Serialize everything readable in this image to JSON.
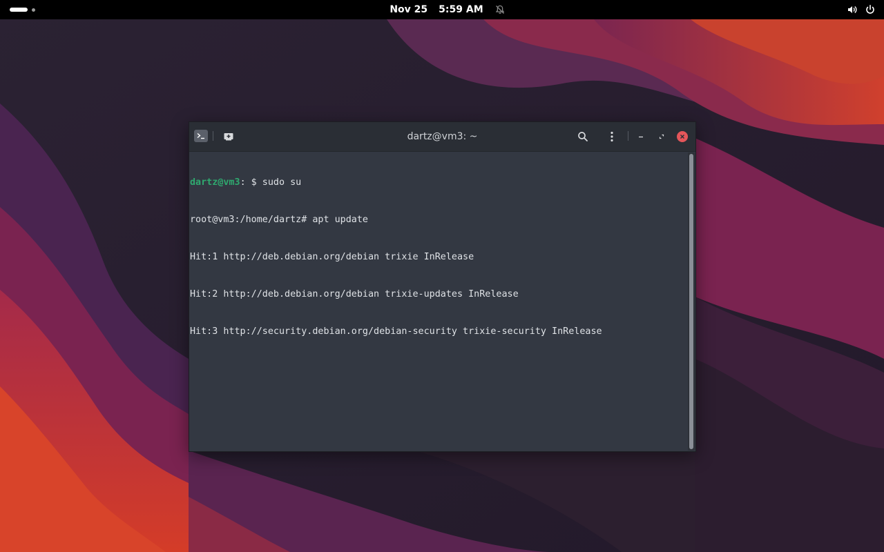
{
  "topbar": {
    "date": "Nov 25",
    "time": "5:59 AM"
  },
  "icons": {
    "notifications_muted": "bell-off-icon",
    "volume": "volume-icon",
    "power": "power-icon",
    "terminal": "terminal-icon",
    "new_tab": "new-tab-icon",
    "search": "search-icon",
    "menu": "kebab-menu-icon",
    "minimize": "minimize-icon",
    "maximize": "maximize-icon",
    "close": "close-icon"
  },
  "terminal": {
    "title": "dartz@vm3: ~",
    "lines": [
      {
        "user": "dartz@vm3",
        "rest": ": $ sudo su"
      },
      {
        "user": "",
        "rest": "root@vm3:/home/dartz# apt update"
      },
      {
        "user": "",
        "rest": "Hit:1 http://deb.debian.org/debian trixie InRelease"
      },
      {
        "user": "",
        "rest": "Hit:2 http://deb.debian.org/debian trixie-updates InRelease"
      },
      {
        "user": "",
        "rest": "Hit:3 http://security.debian.org/debian-security trixie-security InRelease"
      }
    ]
  },
  "colors": {
    "topbar_bg": "#000000",
    "terminal_bg": "#333842",
    "header_bg": "#2a2e35",
    "prompt_user": "#2fa96f",
    "close_button": "#e4565a"
  }
}
